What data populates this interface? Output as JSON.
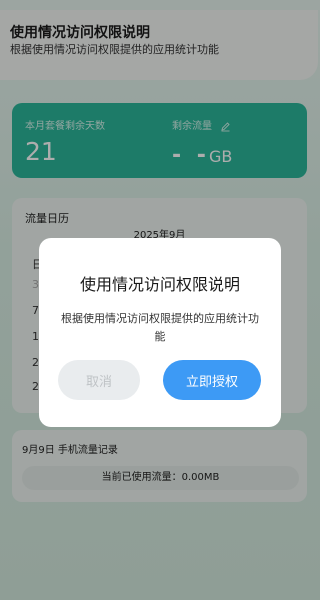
{
  "banner": {
    "title": "使用情况访问权限说明",
    "subtitle": "根据使用情况访问权限提供的应用统计功能"
  },
  "plan": {
    "days_label": "本月套餐剩余天数",
    "days_value": "21",
    "flow_label": "剩余流量",
    "flow_value": "- -",
    "flow_unit": "GB",
    "edit_icon": "pencil-icon"
  },
  "calendar": {
    "title": "流量日历",
    "month": "2025年9月",
    "visible_cells": [
      "日",
      "3",
      "7",
      "14",
      "21",
      "28"
    ]
  },
  "record": {
    "header": "9月9日   手机流量记录",
    "used_text": "当前已使用流量：0.00MB"
  },
  "dialog": {
    "title": "使用情况访问权限说明",
    "body": "根据使用情况访问权限提供的应用统计功能",
    "cancel_label": "取消",
    "grant_label": "立即授权"
  },
  "colors": {
    "accent": "#2bb59a",
    "primary_button": "#3d9af5"
  }
}
